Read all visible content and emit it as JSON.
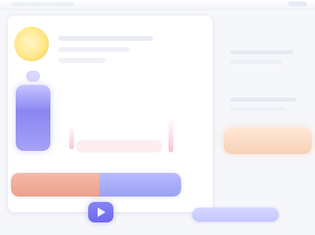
{
  "window": {
    "title": ""
  },
  "colors": {
    "accent": "#7a76f1",
    "warm": "#eca08c",
    "highlight": "#ffe88a"
  },
  "icons": {
    "logo": "sun-icon",
    "play": "play-icon"
  }
}
